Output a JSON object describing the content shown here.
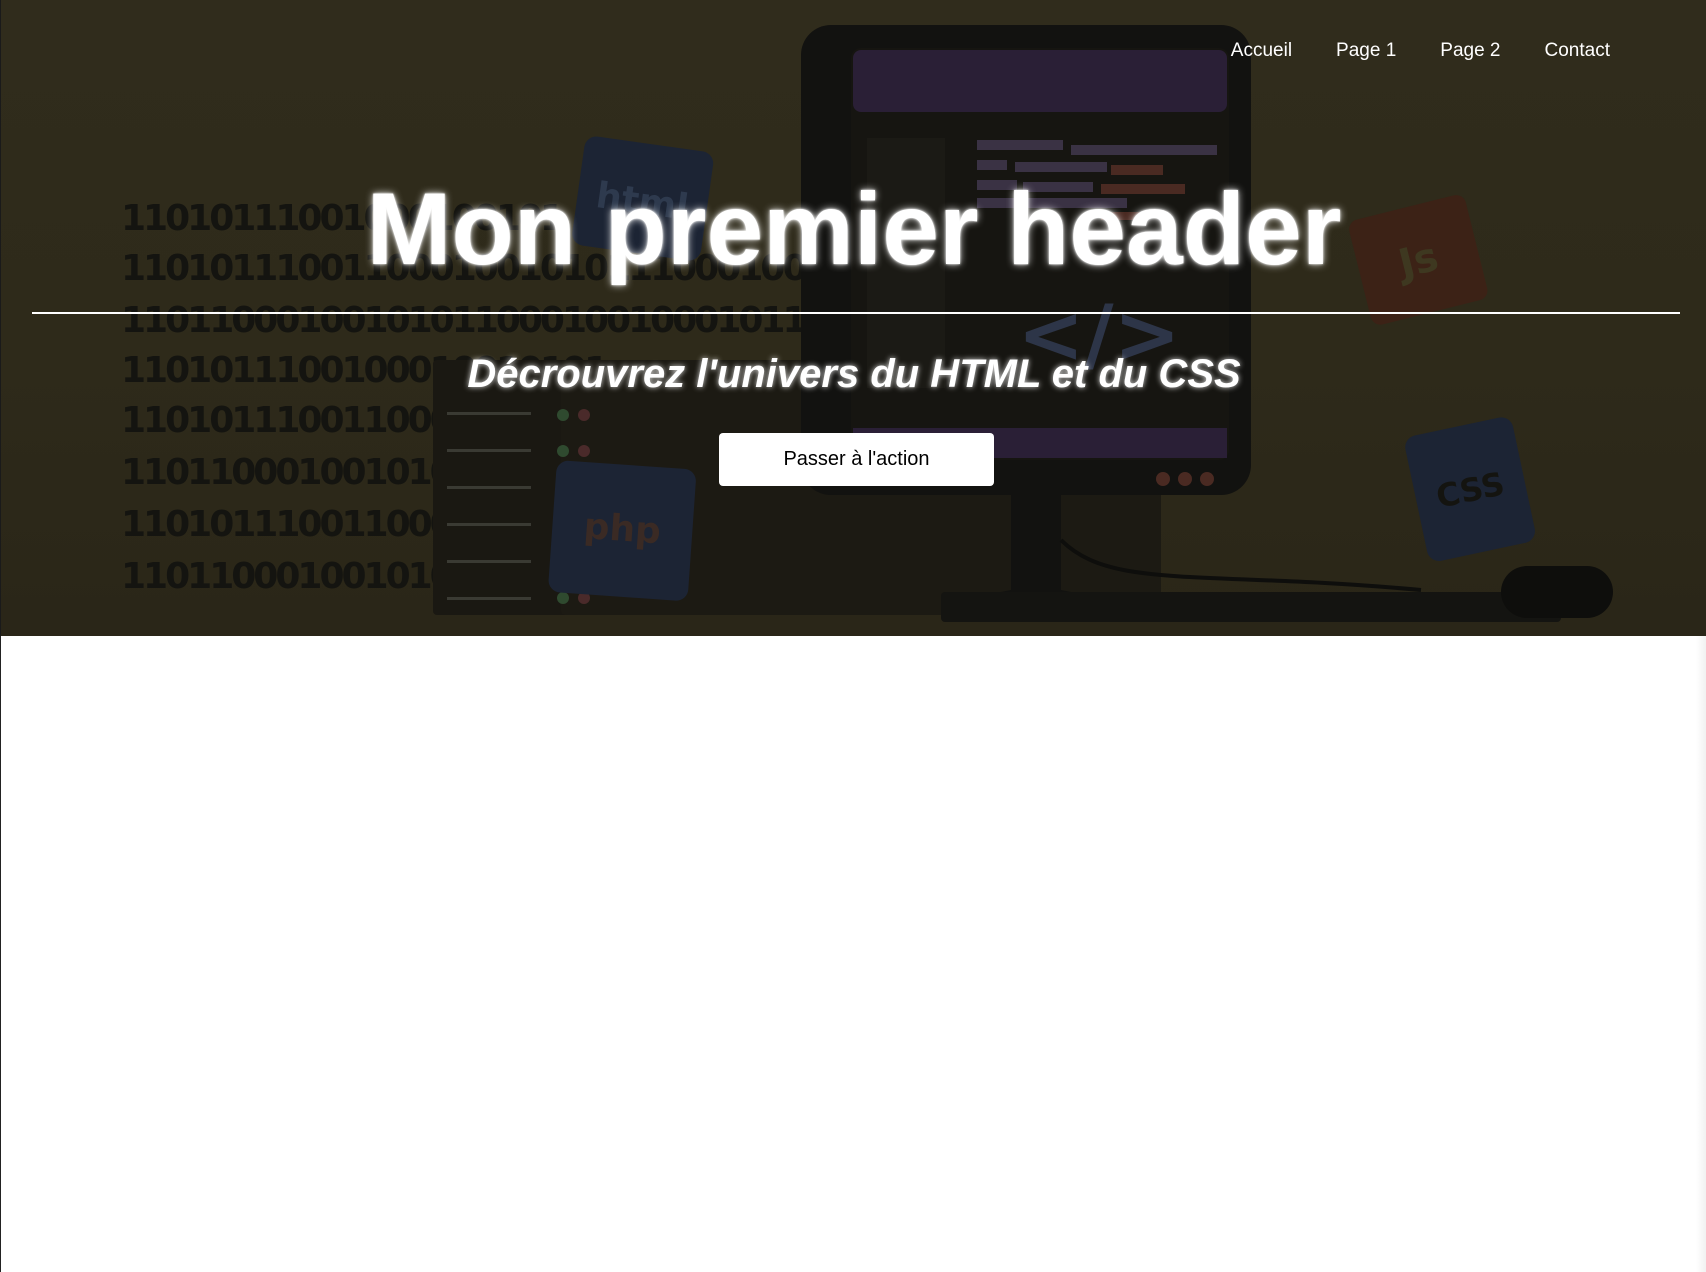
{
  "nav": {
    "items": [
      {
        "label": "Accueil"
      },
      {
        "label": "Page 1"
      },
      {
        "label": "Page 2"
      },
      {
        "label": "Contact"
      }
    ]
  },
  "hero": {
    "title": "Mon premier header",
    "subtitle": "Décrouvrez l'univers du HTML et du CSS",
    "cta_label": "Passer à l'action",
    "binary_lines": [
      "11010111001000100101",
      "1101011100110001001010111000100100010111000001",
      "1101100010010101100010010001011010001010101101",
      "1101011100100010010101",
      "110101110011000100101",
      "11011000100101011000",
      "110101110011000100101",
      "11011000100101011000"
    ],
    "tiles": {
      "html": "html",
      "js": "Js",
      "css": "CSS",
      "php": "php",
      "code": "</>"
    }
  },
  "colors": {
    "hero_overlay": "#2e2a1a",
    "text": "#ffffff",
    "button_bg": "#ffffff",
    "button_text": "#000000"
  }
}
